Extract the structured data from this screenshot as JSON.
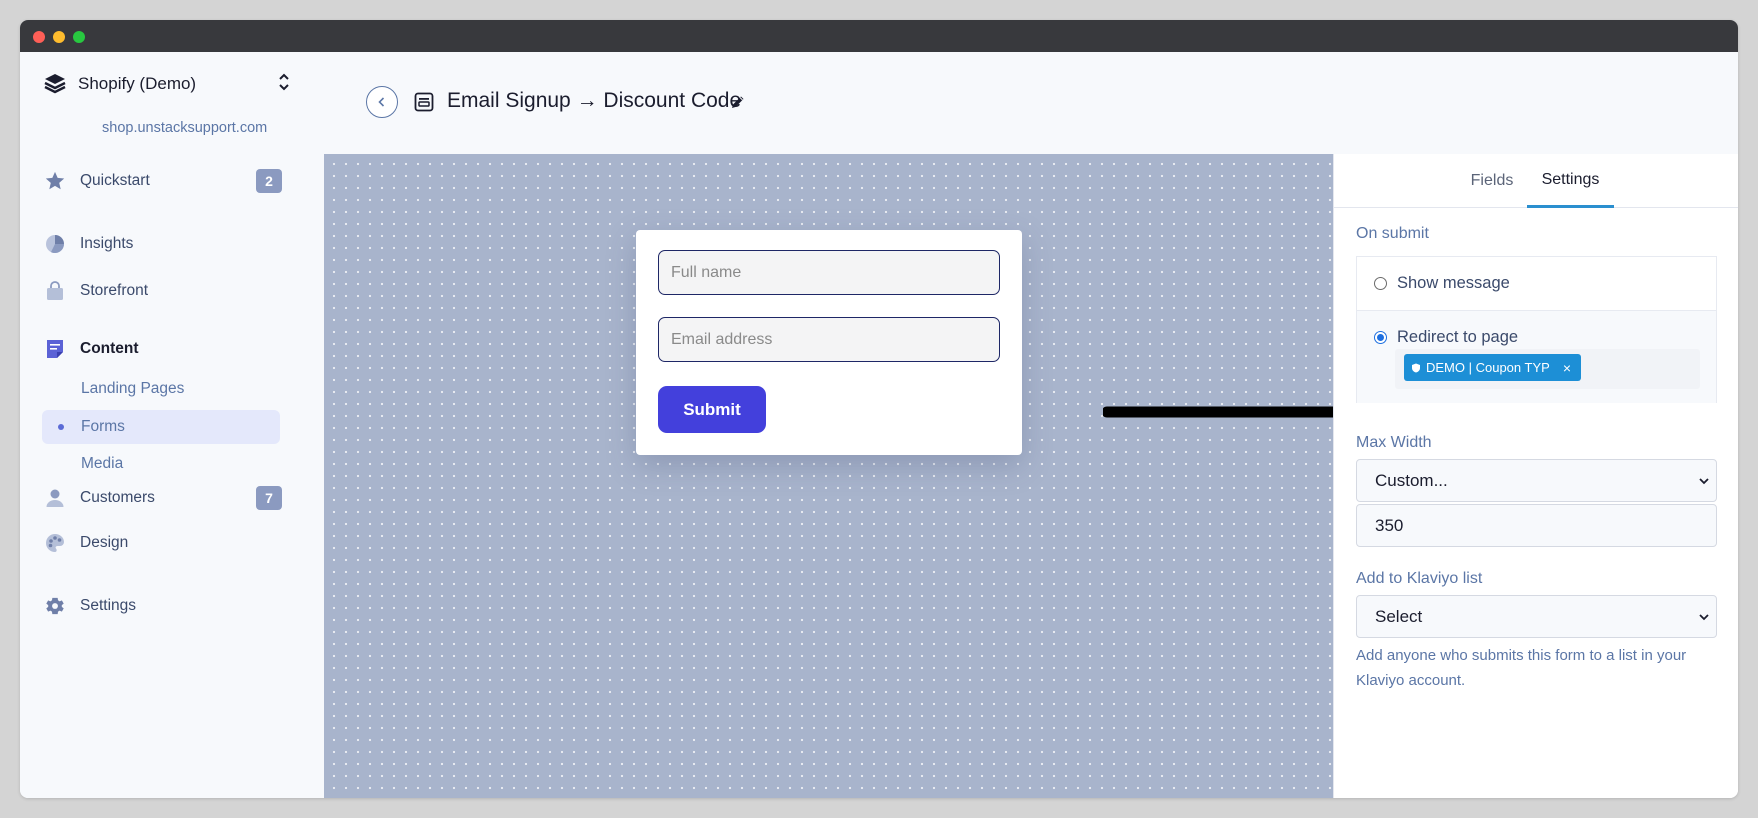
{
  "store": {
    "name": "Shopify (Demo)",
    "url": "shop.unstacksupport.com"
  },
  "sidebar": {
    "items": [
      {
        "label": "Quickstart",
        "icon": "star-icon",
        "badge": "2"
      },
      {
        "label": "Insights",
        "icon": "pie-chart-icon"
      },
      {
        "label": "Storefront",
        "icon": "shopping-bag-icon"
      },
      {
        "label": "Content",
        "icon": "document-icon"
      },
      {
        "label": "Customers",
        "icon": "user-icon",
        "badge": "7"
      },
      {
        "label": "Design",
        "icon": "palette-icon"
      },
      {
        "label": "Settings",
        "icon": "gear-icon"
      }
    ],
    "content_sub": [
      {
        "label": "Landing Pages"
      },
      {
        "label": "Forms"
      },
      {
        "label": "Media"
      }
    ]
  },
  "header": {
    "title": "Email Signup → Discount Code"
  },
  "form_preview": {
    "name_placeholder": "Full name",
    "email_placeholder": "Email address",
    "submit_label": "Submit"
  },
  "panel": {
    "tabs": [
      "Fields",
      "Settings"
    ],
    "active_tab": "Settings",
    "on_submit_label": "On submit",
    "options": [
      "Show message",
      "Redirect to page"
    ],
    "selected_option": "Redirect to page",
    "redirect_tag": "DEMO | Coupon TYP",
    "max_width_label": "Max Width",
    "max_width_select": "Custom...",
    "max_width_value": "350",
    "klaviyo_label": "Add to Klaviyo list",
    "klaviyo_select": "Select",
    "klaviyo_help": "Add anyone who submits this form to a list in your Klaviyo account."
  },
  "colors": {
    "accent": "#4340dc",
    "tab_underline": "#2a8fcf",
    "tag": "#1d8fd6",
    "badge": "#8b9ac0",
    "canvas": "#a8b4cc"
  }
}
